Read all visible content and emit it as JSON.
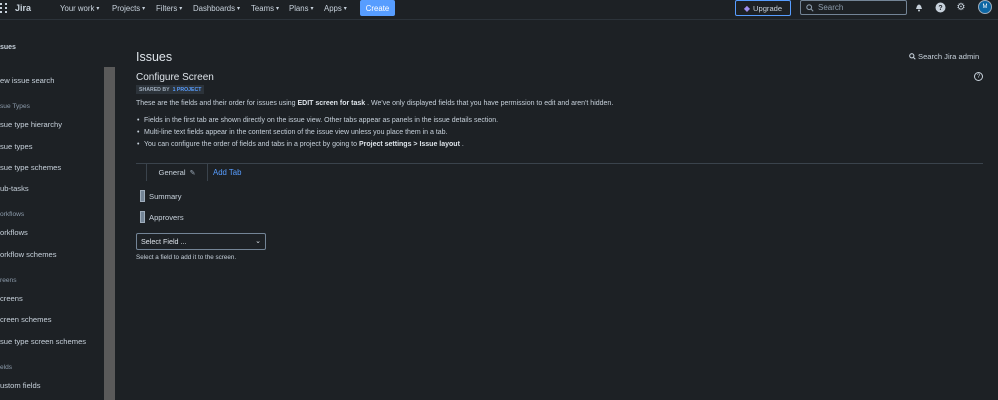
{
  "app": {
    "name": "Jira"
  },
  "nav": {
    "items": [
      {
        "label": "Your work",
        "has_chevron": true
      },
      {
        "label": "Projects",
        "has_chevron": true
      },
      {
        "label": "Filters",
        "has_chevron": true
      },
      {
        "label": "Dashboards",
        "has_chevron": true
      },
      {
        "label": "Teams",
        "has_chevron": true
      },
      {
        "label": "Plans",
        "has_chevron": true
      },
      {
        "label": "Apps",
        "has_chevron": true
      }
    ],
    "create_label": "Create",
    "upgrade_label": "Upgrade",
    "search_placeholder": "Search",
    "avatar_initial": "M"
  },
  "sidebar": {
    "title": "sues",
    "groups": [
      {
        "section": "",
        "links": [
          "ew issue search"
        ]
      },
      {
        "section": "sue Types",
        "links": [
          "sue type hierarchy",
          "sue types",
          "sue type schemes",
          "ub-tasks"
        ]
      },
      {
        "section": "orkflows",
        "links": [
          "orkflows",
          "orkflow schemes"
        ]
      },
      {
        "section": "reens",
        "links": [
          "creens",
          "creen schemes",
          "sue type screen schemes"
        ]
      },
      {
        "section": "elds",
        "links": [
          "ustom fields"
        ]
      }
    ]
  },
  "page": {
    "title": "Issues",
    "search_admin": "Search Jira admin",
    "subtitle": "Configure Screen",
    "shared_by": "SHARED BY",
    "shared_project": "1 PROJECT",
    "description_pre": "These are the fields and their order for issues using ",
    "description_bold": "EDIT screen for task",
    "description_post": " . We've only displayed fields that you have permission to edit and aren't hidden.",
    "bullets": [
      {
        "text": "Fields in the first tab are shown directly on the issue view. Other tabs appear as panels in the issue details section."
      },
      {
        "text": "Multi-line text fields appear in the content section of the issue view unless you place them in a tab."
      }
    ],
    "bullet3_pre": "You can configure the order of fields and tabs in a project by going to ",
    "bullet3_b1": "Project settings",
    "bullet3_sep": " > ",
    "bullet3_b2": "Issue layout",
    "bullet3_post": " .",
    "tab_general": "General",
    "add_tab": "Add Tab",
    "fields": [
      "Summary",
      "Approvers"
    ],
    "select_field_value": "Select Field ...",
    "hint": "Select a field to add it to the screen."
  },
  "colors": {
    "background": "#1d2125",
    "accent": "#579dff",
    "text": "#c7d1db"
  }
}
